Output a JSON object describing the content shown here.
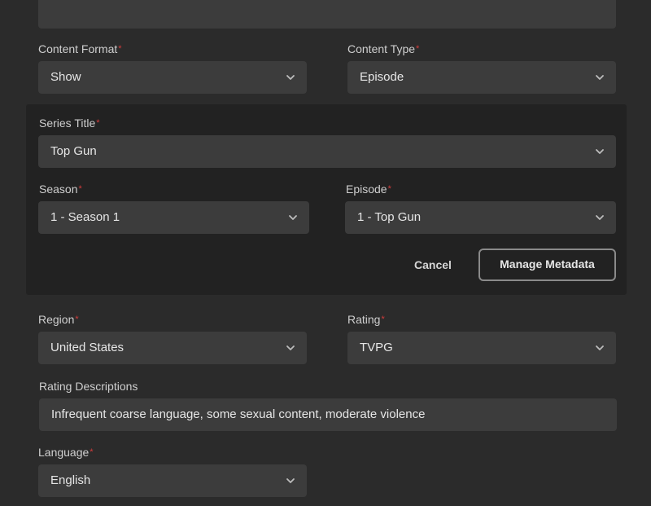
{
  "content_format": {
    "label": "Content Format",
    "required_mark": "*",
    "value": "Show"
  },
  "content_type": {
    "label": "Content Type",
    "required_mark": "*",
    "value": "Episode"
  },
  "series_panel": {
    "series_title": {
      "label": "Series Title",
      "required_mark": "*",
      "value": "Top Gun"
    },
    "season": {
      "label": "Season",
      "required_mark": "*",
      "value": "1 - Season 1"
    },
    "episode": {
      "label": "Episode",
      "required_mark": "*",
      "value": "1 - Top Gun"
    },
    "cancel_label": "Cancel",
    "manage_metadata_label": "Manage Metadata"
  },
  "region": {
    "label": "Region",
    "required_mark": "*",
    "value": "United States"
  },
  "rating": {
    "label": "Rating",
    "required_mark": "*",
    "value": "TVPG"
  },
  "rating_descriptions": {
    "label": "Rating Descriptions",
    "value": "Infrequent coarse language, some sexual content, moderate violence"
  },
  "language": {
    "label": "Language",
    "required_mark": "*",
    "value": "English"
  },
  "colors": {
    "background": "#2b2b2b",
    "panel": "#222222",
    "field": "#3c3c3c",
    "required": "#d23c3c"
  }
}
